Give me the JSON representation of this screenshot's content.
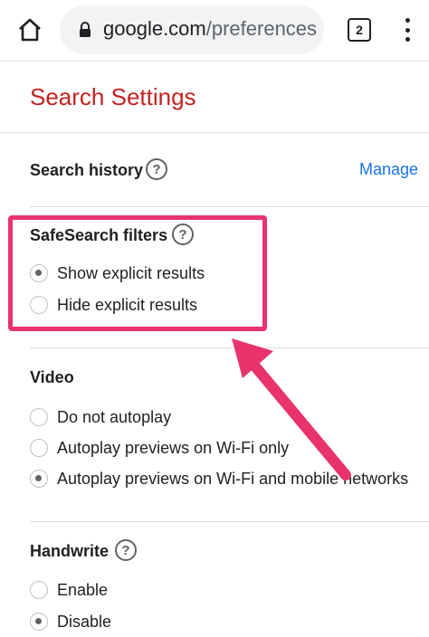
{
  "browser": {
    "url_host": "google.com",
    "url_path": "/preferences",
    "tab_count": "2",
    "home_icon": "home-icon",
    "lock_icon": "lock-icon",
    "menu_icon": "more-vert-icon"
  },
  "page": {
    "title": "Search Settings"
  },
  "search_history": {
    "title": "Search history",
    "help": "?",
    "manage_label": "Manage"
  },
  "safesearch": {
    "title": "SafeSearch filters",
    "help": "?",
    "options": [
      {
        "label": "Show explicit results",
        "checked": true
      },
      {
        "label": "Hide explicit results",
        "checked": false
      }
    ]
  },
  "video": {
    "title": "Video",
    "options": [
      {
        "label": "Do not autoplay",
        "checked": false
      },
      {
        "label": "Autoplay previews on Wi-Fi only",
        "checked": false
      },
      {
        "label": "Autoplay previews on Wi-Fi and mobile networks",
        "checked": true
      }
    ]
  },
  "handwrite": {
    "title": "Handwrite",
    "help": "?",
    "options": [
      {
        "label": "Enable",
        "checked": false
      },
      {
        "label": "Disable",
        "checked": true
      }
    ]
  },
  "colors": {
    "title_red": "#c5221f",
    "link_blue": "#1a73e8",
    "annotation_pink": "#e8336d"
  }
}
